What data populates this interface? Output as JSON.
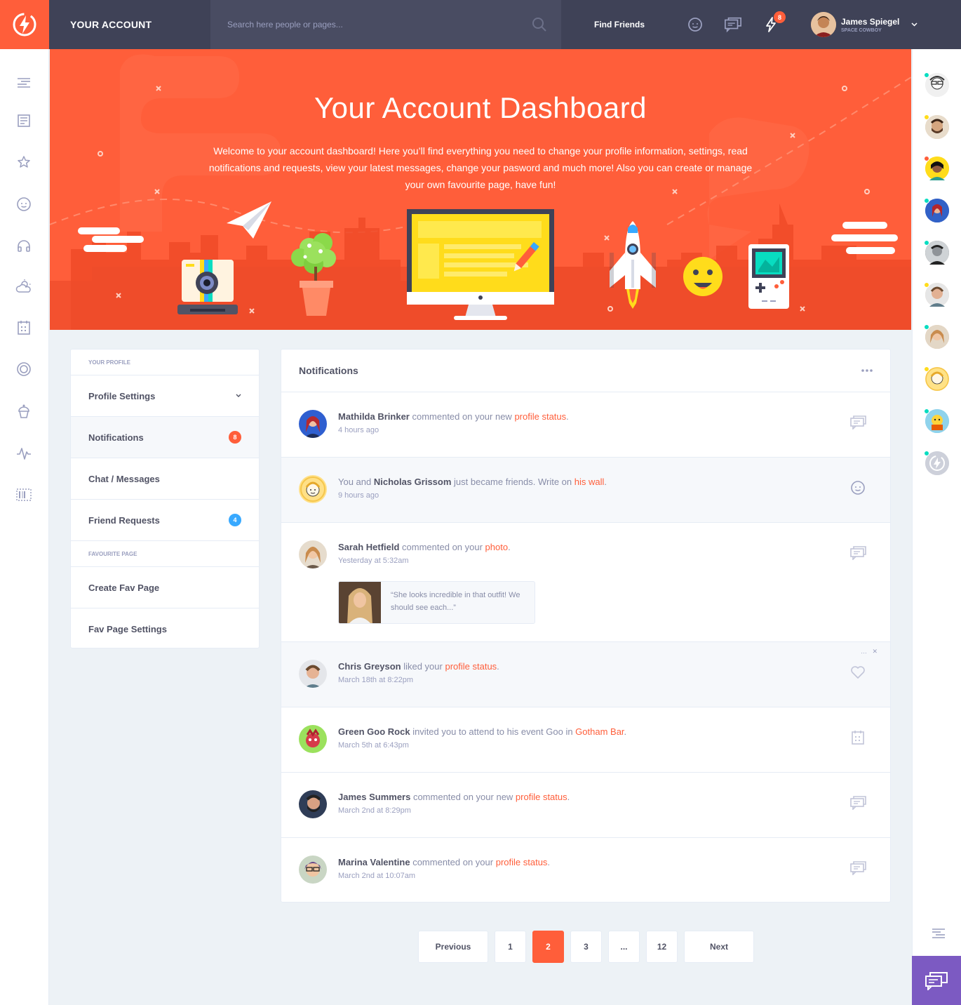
{
  "topbar": {
    "page_name": "YOUR ACCOUNT",
    "search_placeholder": "Search here people or pages...",
    "find_friends": "Find Friends",
    "notif_count": "8",
    "user_name": "James Spiegel",
    "user_subtitle": "SPACE COWBOY"
  },
  "hero": {
    "title": "Your Account Dashboard",
    "text": "Welcome to your account dashboard! Here you’ll find everything you need to change your profile information, settings, read notifications and requests, view your latest messages, change your pasword and much more! Also you can create or manage your own favourite page, have fun!"
  },
  "menu": {
    "section_profile": "YOUR PROFILE",
    "profile_settings": "Profile Settings",
    "notifications": "Notifications",
    "notifications_count": "8",
    "chat_messages": "Chat / Messages",
    "friend_requests": "Friend Requests",
    "friend_requests_count": "4",
    "section_fav": "FAVOURITE PAGE",
    "create_fav": "Create Fav Page",
    "fav_settings": "Fav Page Settings"
  },
  "notifications": {
    "title": "Notifications",
    "items": [
      {
        "name": "Mathilda Brinker",
        "pre": "",
        "text": " commented on your new ",
        "link": "profile status",
        "time": "4 hours ago"
      },
      {
        "name": "Nicholas Grissom",
        "pre": "You and ",
        "text": " just became friends. Write on ",
        "link": "his wall",
        "time": "9 hours ago"
      },
      {
        "name": "Sarah Hetfield",
        "pre": "",
        "text": " commented on your ",
        "link": "photo",
        "time": "Yesterday at 5:32am",
        "quote": "“She looks incredible in that outfit! We should see each...”"
      },
      {
        "name": "Chris Greyson",
        "pre": "",
        "text": " liked your ",
        "link": "profile status",
        "time": "March 18th at 8:22pm"
      },
      {
        "name": "Green Goo Rock",
        "pre": "",
        "text": " invited you to attend to his event Goo in ",
        "link": "Gotham Bar",
        "time": "March 5th at 6:43pm"
      },
      {
        "name": "James Summers",
        "pre": "",
        "text": " commented on your new ",
        "link": "profile status",
        "time": "March 2nd at 8:29pm"
      },
      {
        "name": "Marina Valentine",
        "pre": "",
        "text": " commented on your ",
        "link": "profile status",
        "time": "March 2nd at 10:07am"
      }
    ]
  },
  "pagination": {
    "previous": "Previous",
    "pages": [
      "1",
      "2",
      "3",
      "...",
      "12"
    ],
    "current": "2",
    "next": "Next"
  },
  "colors": {
    "accent": "#ff5e3a",
    "dark": "#3f4257",
    "purple": "#7c5ac2",
    "blue": "#38a9ff",
    "green": "#08ddc1",
    "yellow": "#ffdc1b"
  }
}
